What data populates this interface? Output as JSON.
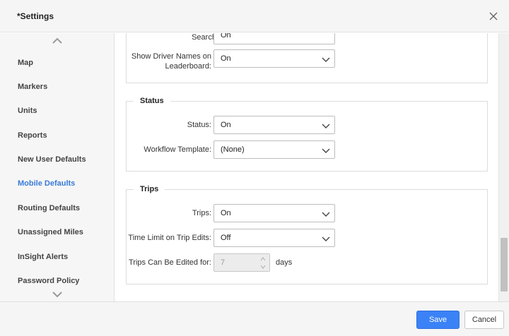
{
  "dialog": {
    "title": "*Settings"
  },
  "sidebar": {
    "items": [
      {
        "label": "Map",
        "active": false
      },
      {
        "label": "Markers",
        "active": false
      },
      {
        "label": "Units",
        "active": false
      },
      {
        "label": "Reports",
        "active": false
      },
      {
        "label": "New User Defaults",
        "active": false
      },
      {
        "label": "Mobile Defaults",
        "active": true
      },
      {
        "label": "Routing Defaults",
        "active": false
      },
      {
        "label": "Unassigned Miles",
        "active": false
      },
      {
        "label": "InSight Alerts",
        "active": false
      },
      {
        "label": "Password Policy",
        "active": false
      }
    ]
  },
  "sections": {
    "leaderboard": {
      "partial_label": "Search:",
      "partial_value": "On",
      "driver_names_label_1": "Show Driver Names on",
      "driver_names_label_2": "Leaderboard:",
      "driver_names_value": "On"
    },
    "status": {
      "title": "Status",
      "status_label": "Status:",
      "status_value": "On",
      "workflow_label": "Workflow Template:",
      "workflow_value": "(None)"
    },
    "trips": {
      "title": "Trips",
      "trips_label": "Trips:",
      "trips_value": "On",
      "time_limit_label": "Time Limit on Trip Edits:",
      "time_limit_value": "Off",
      "edit_days_label": "Trips Can Be Edited for:",
      "edit_days_value": "7",
      "edit_days_unit": "days"
    }
  },
  "footer": {
    "save_label": "Save",
    "cancel_label": "Cancel"
  },
  "colors": {
    "accent": "#3b82f6",
    "active_nav": "#3a7bd5"
  },
  "icons": {
    "close": "close-icon",
    "scroll_up": "chevron-up-icon",
    "scroll_down": "chevron-down-icon",
    "dropdown": "chevron-down-icon"
  }
}
